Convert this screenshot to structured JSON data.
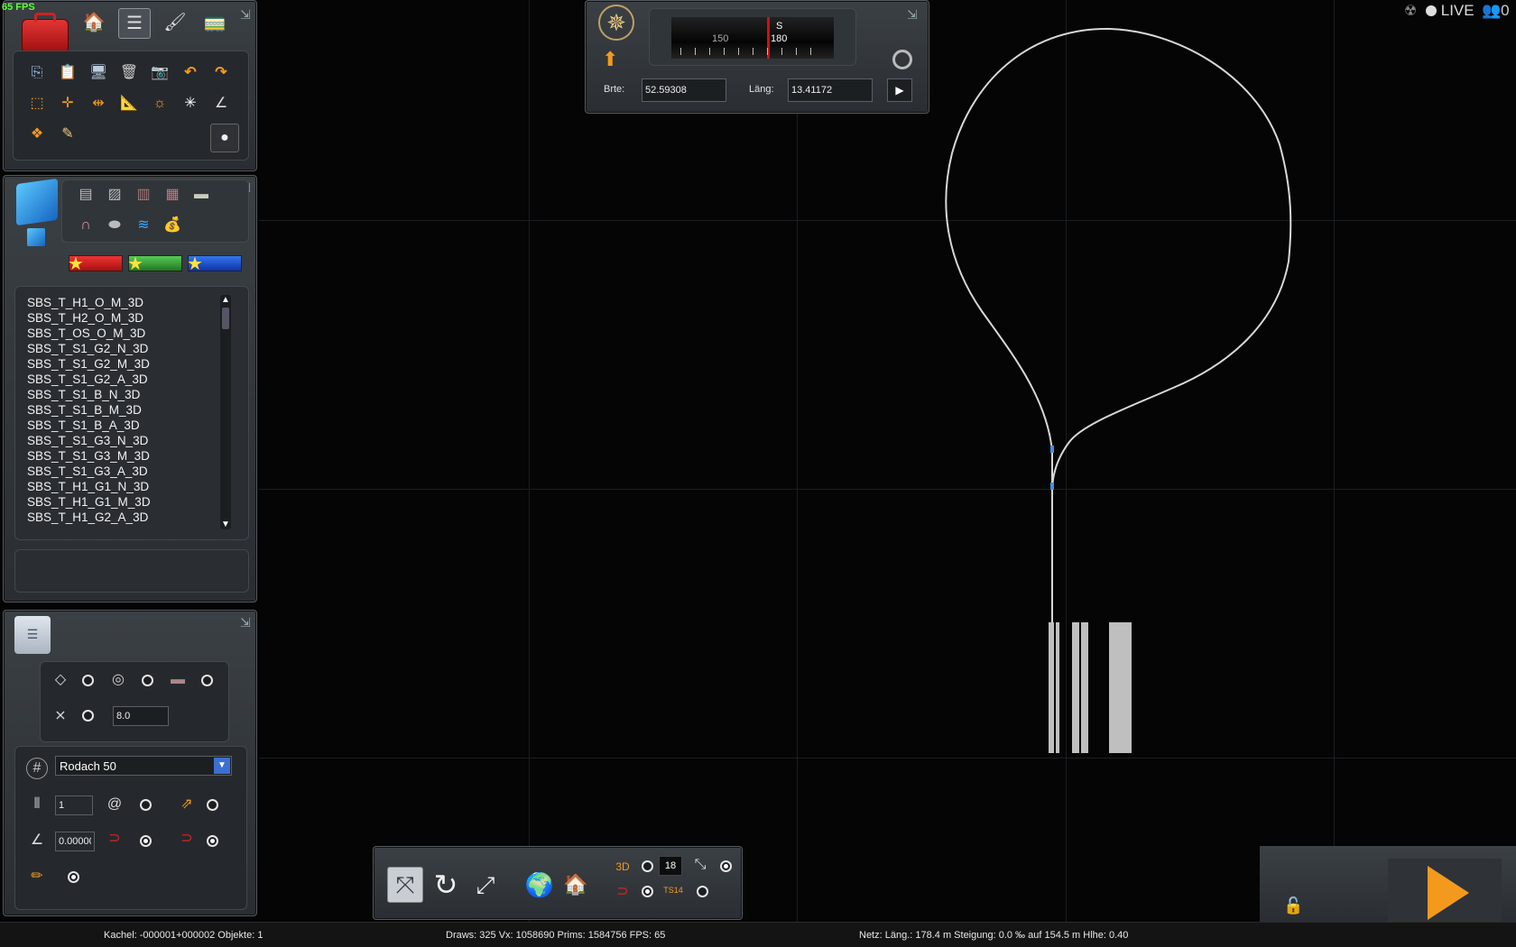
{
  "overlay": {
    "fps": "65 FPS"
  },
  "top_right": {
    "live_label": "LIVE",
    "users_count": "0"
  },
  "toolbox": {
    "tabs": [
      "toolbox-icon",
      "home-icon",
      "track-icon",
      "paintbrush-icon",
      "train-icon"
    ],
    "tool_rows": [
      [
        "copy-icon",
        "paste-icon",
        "screen-icon",
        "delete-icon",
        "camera-icon",
        "undo-icon",
        "redo-icon"
      ],
      [
        "select-box-icon",
        "split-icon",
        "join-icon",
        "ruler-icon",
        "sun-icon",
        "snap-icon",
        "angle-icon"
      ],
      [
        "stack-icon",
        "measure-icon"
      ]
    ]
  },
  "asset_panel": {
    "categories": [
      "track-straight-icon",
      "track-diagonal-icon",
      "track-plank-icon",
      "brick-icon",
      "stone-icon",
      "arch-icon",
      "road-icon",
      "water-icon",
      "bag-icon"
    ],
    "favorites": [
      "red",
      "green",
      "blue"
    ],
    "items": [
      "SBS_T_H1_O_M_3D",
      "SBS_T_H2_O_M_3D",
      "SBS_T_OS_O_M_3D",
      "SBS_T_S1_G2_N_3D",
      "SBS_T_S1_G2_M_3D",
      "SBS_T_S1_G2_A_3D",
      "SBS_T_S1_B_N_3D",
      "SBS_T_S1_B_M_3D",
      "SBS_T_S1_B_A_3D",
      "SBS_T_S1_G3_N_3D",
      "SBS_T_S1_G3_M_3D",
      "SBS_T_S1_G3_A_3D",
      "SBS_T_H1_G1_N_3D",
      "SBS_T_H1_G1_M_3D",
      "SBS_T_H1_G2_A_3D"
    ]
  },
  "properties": {
    "snap_value": "8.0",
    "track_select": "Rodach 50",
    "count_value": "1",
    "angle_value": "0.000000"
  },
  "compass": {
    "heading_letter": "S",
    "ticks": [
      "150",
      "180"
    ],
    "lat_label": "Brte:",
    "lat_value": "52.59308",
    "lon_label": "Läng:",
    "lon_value": "13.41172"
  },
  "bottom_toolbar": {
    "zoom_value": "18"
  },
  "status": {
    "tile": "Kachel: -000001+000002  Objekte: 1",
    "render": "Draws: 325 Vx: 1058690 Prims: 1584756 FPS: 65",
    "net": "Netz:  Läng.:  178.4 m Steigung:  0.0 ‰ auf 154.5 m Hlhe:   0.40"
  },
  "colors": {
    "accent_orange": "#f39a1e",
    "track_line": "#d8d8d8",
    "fps_green": "#5cff38"
  }
}
